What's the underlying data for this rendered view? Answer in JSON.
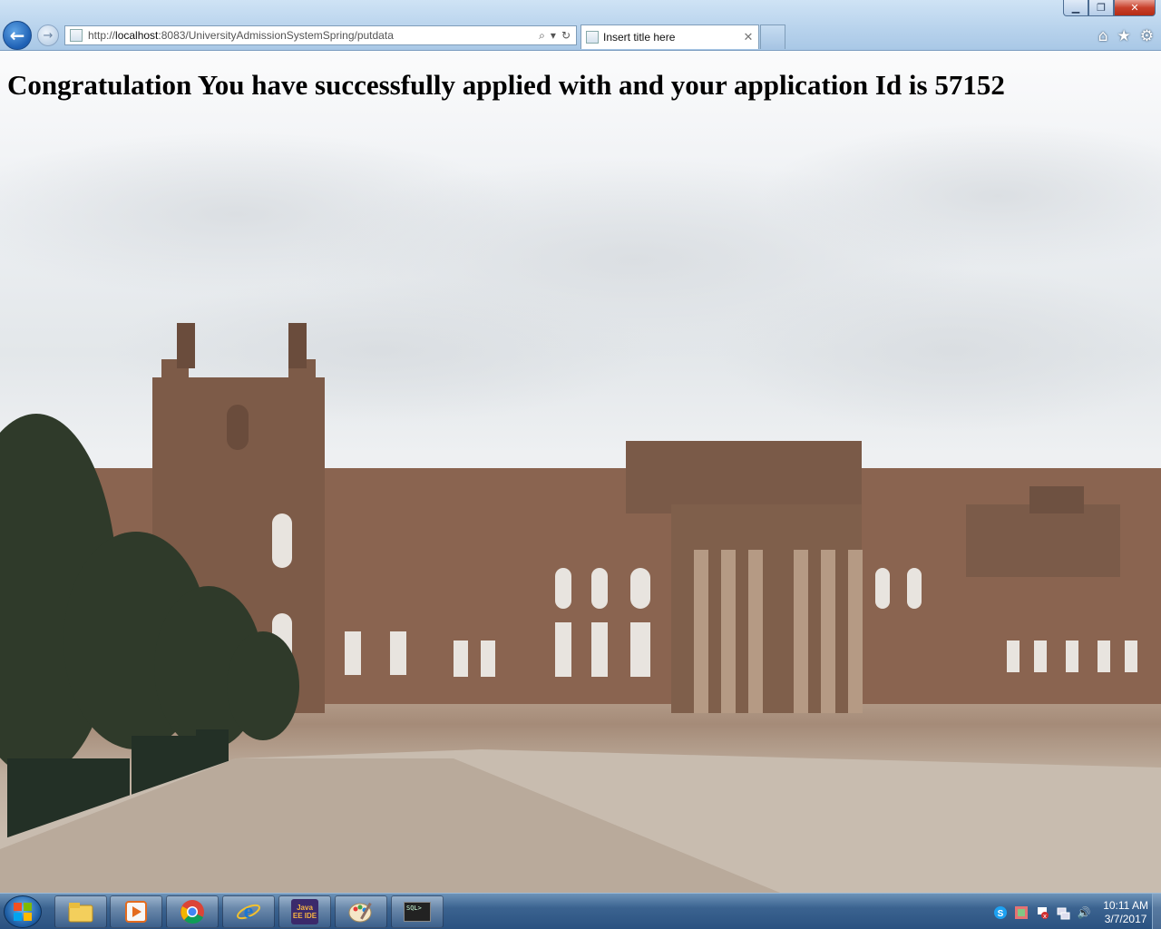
{
  "browser": {
    "url_prefix": "http://",
    "url_host": "localhost",
    "url_rest": ":8083/UniversityAdmissionSystemSpring/putdata",
    "tab_title": "Insert title here"
  },
  "page": {
    "headline": "Congratulation You have successfully applied with and your application Id is 57152"
  },
  "taskbar": {
    "apps": [
      "file-explorer-icon",
      "media-player-icon",
      "chrome-icon",
      "internet-explorer-icon",
      "java-ee-ide-icon",
      "paint-icon",
      "sqlplus-icon"
    ],
    "java_ide_label": "Java EE IDE",
    "sql_label": "SQL>",
    "clock_time": "10:11 AM",
    "clock_date": "3/7/2017"
  }
}
